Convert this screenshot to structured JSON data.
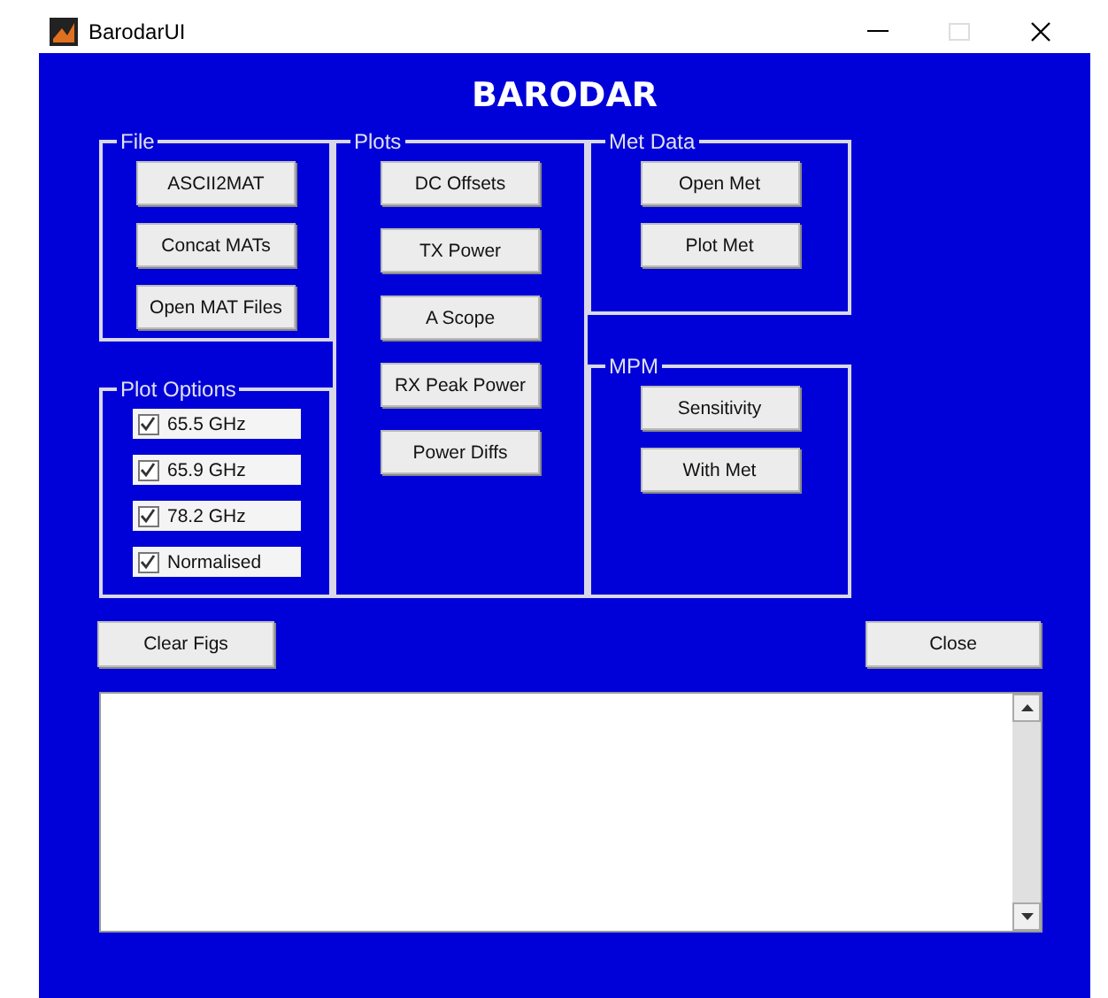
{
  "window": {
    "title": "BarodarUI"
  },
  "heading": "BARODAR",
  "panels": [
    {
      "title": "File",
      "items": [
        {
          "kind": "button",
          "label": "ASCII2MAT"
        },
        {
          "kind": "button",
          "label": "Concat MATs"
        },
        {
          "kind": "button",
          "label": "Open MAT Files"
        }
      ]
    },
    {
      "title": "Plot Options",
      "items": [
        {
          "kind": "checkbox",
          "label": "65.5 GHz",
          "checked": true
        },
        {
          "kind": "checkbox",
          "label": "65.9 GHz",
          "checked": true
        },
        {
          "kind": "checkbox",
          "label": "78.2 GHz",
          "checked": true
        },
        {
          "kind": "checkbox",
          "label": "Normalised",
          "checked": true
        }
      ]
    },
    {
      "title": "Plots",
      "items": [
        {
          "kind": "button",
          "label": "DC Offsets"
        },
        {
          "kind": "button",
          "label": "TX Power"
        },
        {
          "kind": "button",
          "label": "A Scope"
        },
        {
          "kind": "button",
          "label": "RX Peak Power"
        },
        {
          "kind": "button",
          "label": "Power Diffs"
        }
      ]
    },
    {
      "title": "Met Data",
      "items": [
        {
          "kind": "button",
          "label": "Open Met"
        },
        {
          "kind": "button",
          "label": "Plot Met"
        }
      ]
    },
    {
      "title": "MPM",
      "items": [
        {
          "kind": "button",
          "label": "Sensitivity"
        },
        {
          "kind": "button",
          "label": "With Met"
        }
      ]
    }
  ],
  "buttons": [
    "Clear Figs",
    "Close"
  ]
}
